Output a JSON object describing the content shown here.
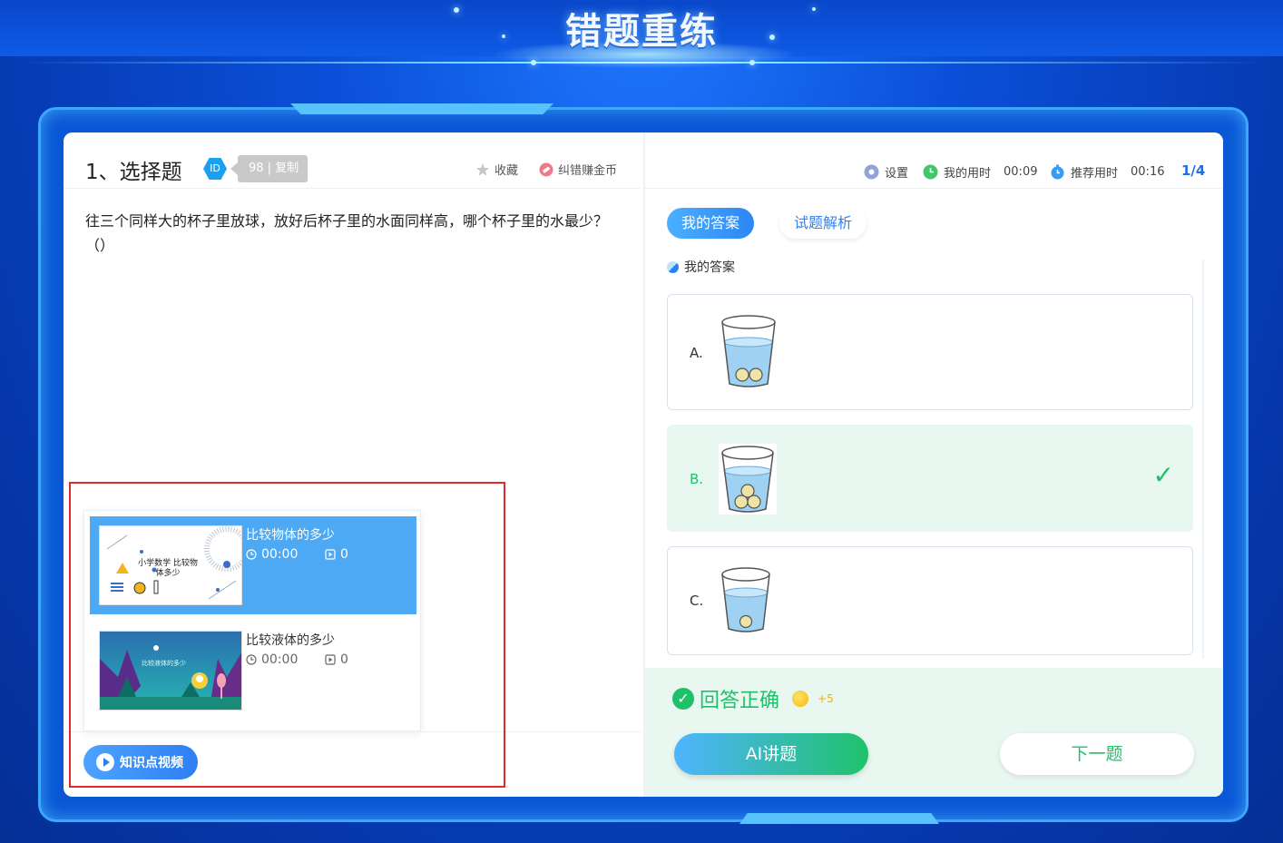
{
  "header": {
    "title": "错题重练"
  },
  "question": {
    "title": "1、选择题",
    "id_badge": "ID",
    "id_value": "98 | 复制",
    "favorite_label": "收藏",
    "correct_coins_label": "纠错赚金币",
    "text": "往三个同样大的杯子里放球，放好后杯子里的水面同样高，哪个杯子里的水最少？（）"
  },
  "videos": [
    {
      "title": "比较物体的多少",
      "duration": "00:00",
      "count": "0",
      "thumb_text": "小学数学 比较物体多少",
      "active": true
    },
    {
      "title": "比较液体的多少",
      "duration": "00:00",
      "count": "0",
      "thumb_text": "比较液体的多少",
      "active": false
    }
  ],
  "knowledge_video_button": "知识点视频",
  "toolbar": {
    "settings_label": "设置",
    "my_time_label": "我的用时",
    "my_time_value": "00:09",
    "recommended_time_label": "推荐用时",
    "recommended_time_value": "00:16",
    "page": "1/4"
  },
  "tabs": {
    "my_answer": "我的答案",
    "analysis": "试题解析"
  },
  "answer_section_label": "我的答案",
  "options": [
    {
      "label": "A.",
      "balls": 2,
      "correct": false
    },
    {
      "label": "B.",
      "balls": 3,
      "correct": true
    },
    {
      "label": "C.",
      "balls": 1,
      "correct": false
    }
  ],
  "result": {
    "text": "回答正确",
    "reward": "+5"
  },
  "buttons": {
    "ai_explain": "AI讲题",
    "next": "下一题"
  },
  "colors": {
    "correct": "#20c06a",
    "accent": "#2e7ff3",
    "highlight_box": "#e02a2a"
  }
}
